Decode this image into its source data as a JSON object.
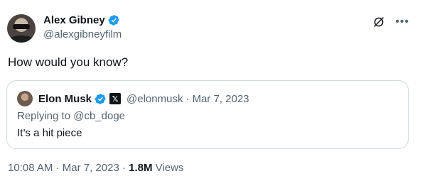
{
  "author": {
    "name": "Alex Gibney",
    "handle": "@alexgibneyfilm"
  },
  "tweet": {
    "text": "How would you know?"
  },
  "quoted": {
    "name": "Elon Musk",
    "handle": "@elonmusk",
    "separator": "·",
    "date": "Mar 7, 2023",
    "reply_prefix": "Replying to",
    "reply_to": "@cb_doge",
    "text": "It’s a hit piece",
    "badge_glyph": "𝕏"
  },
  "footer": {
    "time": "10:08 AM",
    "separator": "·",
    "date": "Mar 7, 2023",
    "separator2": "·",
    "views_count": "1.8M",
    "views_label": "Views"
  },
  "icons": {
    "verified": "verified-badge-icon",
    "grok": "grok-icon",
    "more": "more-icon"
  },
  "colors": {
    "verified_blue": "#1d9bf0",
    "secondary_text": "#536471",
    "primary_text": "#0f1419",
    "border": "#cfd9de"
  }
}
